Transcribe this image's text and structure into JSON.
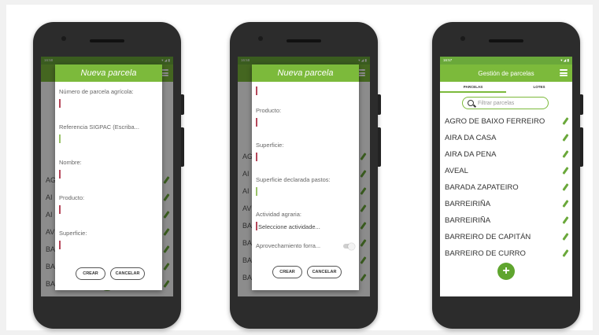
{
  "status": {
    "time_1": "16:58",
    "time_2": "16:58",
    "time_3": "16:57",
    "icons": "▾ ◢ ▮"
  },
  "dialog_1": {
    "title": "Nueva parcela",
    "fields": [
      "Número de parcela agrícola:",
      "Referencia SIGPAC (Escriba...",
      "Nombre:",
      "Producto:",
      "Superficie:"
    ],
    "create_label": "CREAR",
    "cancel_label": "CANCELAR"
  },
  "dialog_2": {
    "title": "Nueva parcela",
    "fields": [
      "Producto:",
      "Superficie:",
      "Superficie declarada pastos:",
      "Actividad agraria:"
    ],
    "activity_placeholder": "Seleccione actividade...",
    "forage_label": "Aprovechamiento forra...",
    "create_label": "CREAR",
    "cancel_label": "CANCELAR"
  },
  "bg_letters_1": [
    "AG",
    "AI",
    "AI",
    "AV",
    "BA",
    "BA",
    "BA",
    "BA",
    "BA"
  ],
  "bg_letters_2": [
    "AG",
    "AI",
    "AI",
    "AV",
    "BA",
    "BA",
    "BA",
    "BA",
    "BA"
  ],
  "screen_3": {
    "title": "Gestión de parcelas",
    "tabs": [
      "PARCELAS",
      "LOTES"
    ],
    "filter_placeholder": "Filtrar parcelas",
    "items": [
      "AGRO DE BAIXO FERREIRO",
      "AIRA DA CASA",
      "AIRA DA PENA",
      "AVEAL",
      "BARADA ZAPATEIRO",
      "BARREIRIÑA",
      "BARREIRIÑA",
      "BARREIRO DE CAPITÁN",
      "BARREIRO DE CURRO"
    ],
    "fab_symbol": "+"
  },
  "colors": {
    "accent": "#7cba3b",
    "accent_dark": "#5fa52e",
    "cursor": "#b5475a"
  },
  "icons": [
    "menu-icon",
    "search-icon",
    "pencil-icon",
    "plus-icon"
  ]
}
